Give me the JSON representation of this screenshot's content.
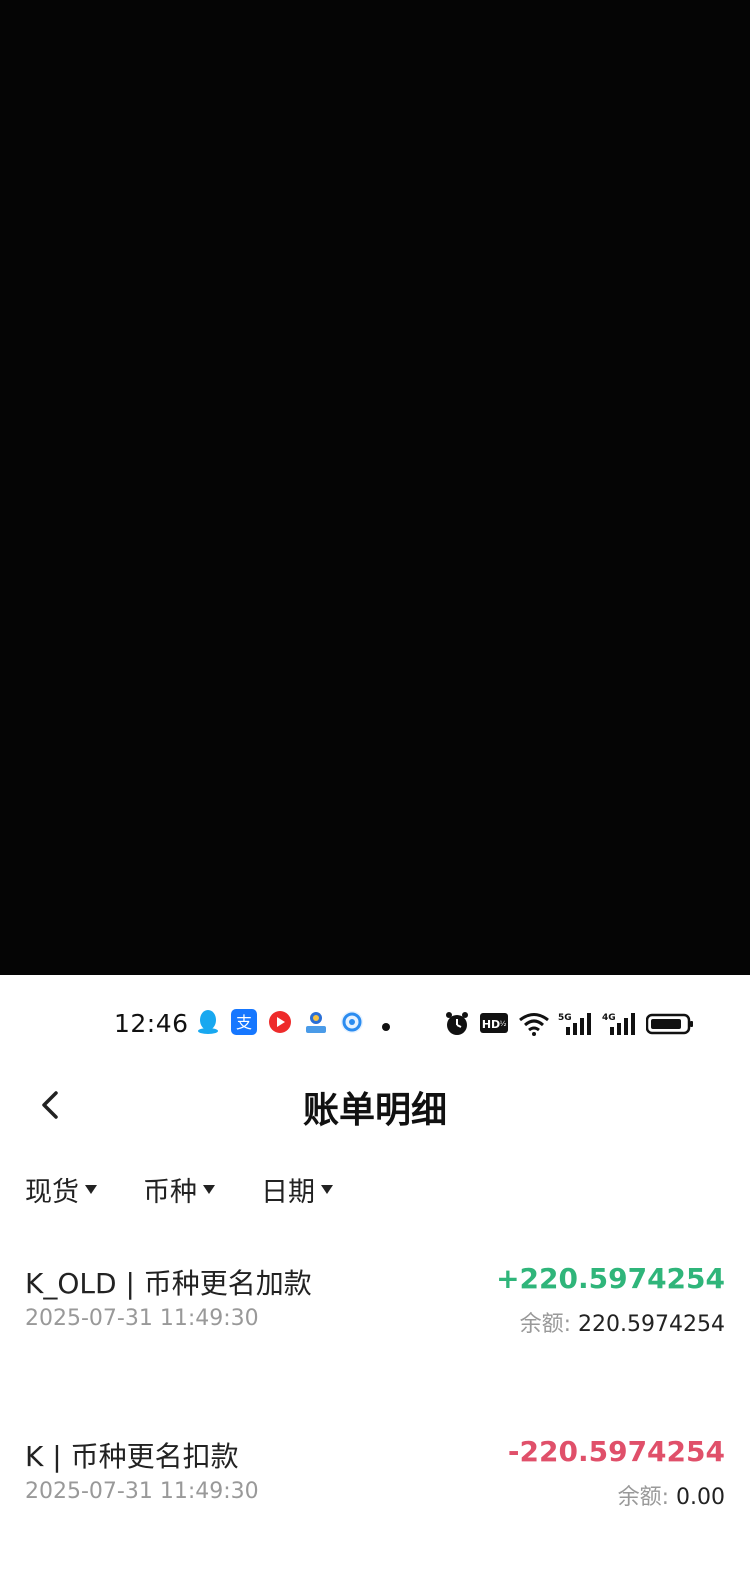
{
  "status_bar": {
    "time": "12:46",
    "left_icons": [
      "qq-icon",
      "alipay-icon",
      "video-app-icon",
      "bank-app-icon",
      "browser-icon",
      "dot-icon"
    ],
    "right_icons": [
      "alarm-icon",
      "hd-icon",
      "wifi-icon",
      "signal-5g-icon",
      "signal-4g-icon",
      "battery-icon"
    ],
    "alipay_glyph": "支",
    "hd_text": "HD",
    "net_5g": "5G",
    "net_4g": "4G"
  },
  "nav": {
    "title": "账单明细",
    "back_icon": "chevron-left-icon"
  },
  "filters": [
    {
      "label": "现货"
    },
    {
      "label": "币种"
    },
    {
      "label": "日期"
    }
  ],
  "transactions": [
    {
      "title": "K_OLD | 币种更名加款",
      "datetime": "2025-07-31 11:49:30",
      "amount": "+220.5974254",
      "balance_label": "余额:",
      "balance_value": "220.5974254",
      "type": "credit"
    },
    {
      "title": "K | 币种更名扣款",
      "datetime": "2025-07-31 11:49:30",
      "amount": "-220.5974254",
      "balance_label": "余额:",
      "balance_value": "0.00",
      "type": "debit"
    }
  ],
  "colors": {
    "positive": "#2fb57a",
    "negative": "#e0506a",
    "muted": "#999999",
    "text": "#222222",
    "top_area": "#050505"
  }
}
